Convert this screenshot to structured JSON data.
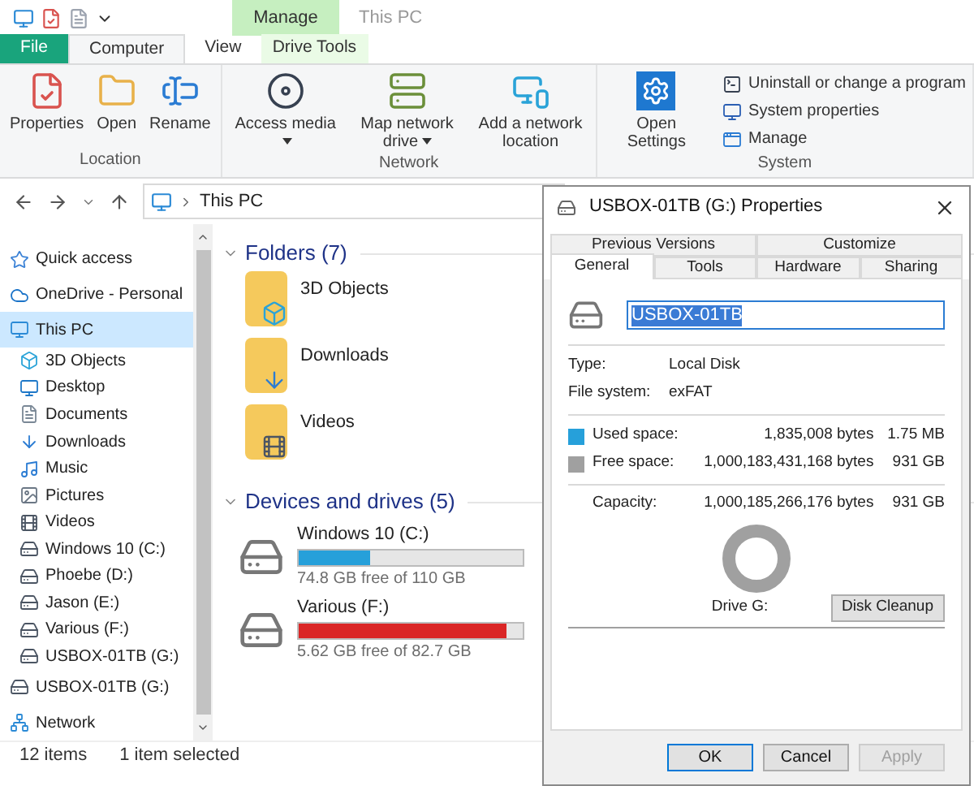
{
  "title_bar": {
    "title": "This PC",
    "contextual_tab": "Manage"
  },
  "ribbon_tabs": [
    {
      "label": "File",
      "kind": "file",
      "selected": false
    },
    {
      "label": "Computer",
      "kind": "tab",
      "selected": true
    },
    {
      "label": "View",
      "kind": "tab",
      "selected": false
    },
    {
      "label": "Drive Tools",
      "kind": "contextual",
      "selected": false
    }
  ],
  "ribbon_groups": [
    {
      "label": "Location",
      "buttons": [
        {
          "label": "Properties",
          "dropdown": false
        },
        {
          "label": "Open",
          "dropdown": false
        },
        {
          "label": "Rename",
          "dropdown": false
        }
      ]
    },
    {
      "label": "Network",
      "buttons": [
        {
          "label": "Access media",
          "dropdown": true
        },
        {
          "label": "Map network drive",
          "dropdown": true
        },
        {
          "label": "Add a network location",
          "dropdown": false
        }
      ]
    },
    {
      "label": "System",
      "buttons": [
        {
          "label": "Open Settings",
          "dropdown": false
        }
      ],
      "small_buttons": [
        {
          "label": "Uninstall or change a program"
        },
        {
          "label": "System properties"
        },
        {
          "label": "Manage"
        }
      ]
    }
  ],
  "address": {
    "path": "This PC"
  },
  "nav": [
    {
      "label": "Quick access",
      "selected": false
    },
    {
      "label": "OneDrive - Personal",
      "selected": false
    },
    {
      "label": "This PC",
      "selected": true,
      "children": [
        {
          "label": "3D Objects",
          "selected": false
        },
        {
          "label": "Desktop",
          "selected": false
        },
        {
          "label": "Documents",
          "selected": false
        },
        {
          "label": "Downloads",
          "selected": false
        },
        {
          "label": "Music",
          "selected": false
        },
        {
          "label": "Pictures",
          "selected": false
        },
        {
          "label": "Videos",
          "selected": false
        },
        {
          "label": "Windows 10 (C:)",
          "selected": false
        },
        {
          "label": "Phoebe (D:)",
          "selected": false
        },
        {
          "label": "Jason (E:)",
          "selected": false
        },
        {
          "label": "Various (F:)",
          "selected": false
        },
        {
          "label": "USBOX-01TB (G:)",
          "selected": false
        }
      ]
    },
    {
      "label": "USBOX-01TB (G:)",
      "selected": false
    },
    {
      "label": "Network",
      "selected": false
    }
  ],
  "folders": {
    "title": "Folders (7)",
    "expanded": true,
    "items": [
      {
        "name": "3D Objects"
      },
      {
        "name": "Downloads"
      },
      {
        "name": "Videos"
      }
    ]
  },
  "devices": {
    "title": "Devices and drives (5)",
    "expanded": true,
    "items": [
      {
        "name": "Windows 10 (C:)",
        "level": 0.32,
        "color": "#26a0da",
        "free": "74.8 GB free of 110 GB"
      },
      {
        "name": "Various (F:)",
        "level": 0.93,
        "color": "#da2626",
        "free": "5.62 GB free of 82.7 GB"
      }
    ]
  },
  "status_bar": [
    "12 items",
    "1 item selected"
  ],
  "dialog": {
    "title": "USBOX-01TB (G:) Properties",
    "tab_rows": [
      [
        {
          "label": "Previous Versions",
          "selected": false
        },
        {
          "label": "Customize",
          "selected": false
        }
      ],
      [
        {
          "label": "General",
          "selected": true
        },
        {
          "label": "Tools",
          "selected": false
        },
        {
          "label": "Hardware",
          "selected": false
        },
        {
          "label": "Sharing",
          "selected": false
        }
      ]
    ],
    "name_value": "USBOX-01TB",
    "info": [
      {
        "label": "Type:",
        "value": "Local Disk"
      },
      {
        "label": "File system:",
        "value": "exFAT"
      }
    ],
    "space": [
      {
        "label": "Used space:",
        "bytes": "1,835,008 bytes",
        "size": "1.75 MB",
        "color": "#26a0da"
      },
      {
        "label": "Free space:",
        "bytes": "1,000,183,431,168 bytes",
        "size": "931 GB",
        "color": "#a0a0a0"
      }
    ],
    "capacity": {
      "label": "Capacity:",
      "bytes": "1,000,185,266,176 bytes",
      "size": "931 GB"
    },
    "drive_label": "Drive G:",
    "cleanup_button": "Disk Cleanup",
    "buttons": [
      {
        "label": "OK",
        "default": true,
        "disabled": false
      },
      {
        "label": "Cancel",
        "default": false,
        "disabled": false
      },
      {
        "label": "Apply",
        "default": false,
        "disabled": true
      }
    ]
  }
}
